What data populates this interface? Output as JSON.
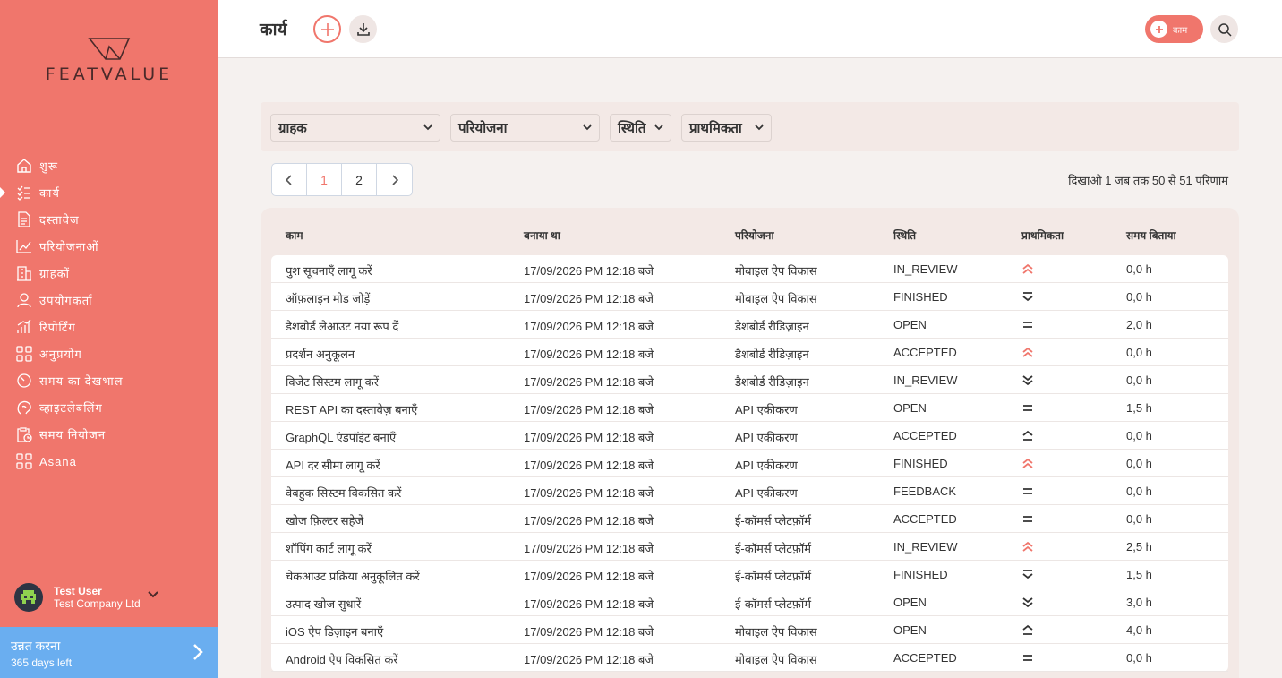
{
  "app": {
    "logo_text": "FEATVALUE",
    "page_title": "कार्य"
  },
  "sidebar": {
    "items": [
      {
        "label": "शुरू",
        "icon": "home-icon"
      },
      {
        "label": "कार्य",
        "icon": "tasks-icon",
        "active": true
      },
      {
        "label": "दस्तावेज",
        "icon": "document-icon"
      },
      {
        "label": "परियोजनाओं",
        "icon": "projects-icon"
      },
      {
        "label": "ग्राहकों",
        "icon": "building-icon"
      },
      {
        "label": "उपयोगकर्ता",
        "icon": "user-icon"
      },
      {
        "label": "रिपोर्टिंग",
        "icon": "chart-icon"
      },
      {
        "label": "अनुप्रयोग",
        "icon": "apps-icon"
      },
      {
        "label": "समय का देखभाल",
        "icon": "timer-icon"
      },
      {
        "label": "व्हाइटलेबलिंग",
        "icon": "brain-icon"
      },
      {
        "label": "समय नियोजन",
        "icon": "clipboard-clock-icon"
      },
      {
        "label": "Asana",
        "icon": "apps-icon"
      }
    ],
    "user": {
      "name": "Test User",
      "company": "Test Company Ltd"
    },
    "upgrade": {
      "title": "उन्नत करना",
      "subtitle": "365 days left"
    }
  },
  "header": {
    "task_button_label": "काम"
  },
  "filters": {
    "customer": "ग्राहक",
    "project": "परियोजना",
    "status": "स्थिति",
    "priority": "प्राथमिकता"
  },
  "pagination": {
    "pages": [
      "1",
      "2"
    ],
    "current": "1",
    "result_text": "दिखाओ 1 जब तक 50 से 51 परिणाम"
  },
  "table": {
    "headers": {
      "task": "काम",
      "created": "बनाया था",
      "project": "परियोजना",
      "status": "स्थिति",
      "priority": "प्राथमिकता",
      "time": "समय बिताया"
    },
    "rows": [
      {
        "task": "पुश सूचनाएँ लागू करें",
        "created": "17/09/2026 PM 12:18 बजे",
        "project": "मोबाइल ऐप विकास",
        "status": "IN_REVIEW",
        "priority": "highest",
        "time": "0,0 h"
      },
      {
        "task": "ऑफ़लाइन मोड जोड़ें",
        "created": "17/09/2026 PM 12:18 बजे",
        "project": "मोबाइल ऐप विकास",
        "status": "FINISHED",
        "priority": "low",
        "time": "0,0 h"
      },
      {
        "task": "डैशबोर्ड लेआउट नया रूप दें",
        "created": "17/09/2026 PM 12:18 बजे",
        "project": "डैशबोर्ड रीडिज़ाइन",
        "status": "OPEN",
        "priority": "medium",
        "time": "2,0 h"
      },
      {
        "task": "प्रदर्शन अनुकूलन",
        "created": "17/09/2026 PM 12:18 बजे",
        "project": "डैशबोर्ड रीडिज़ाइन",
        "status": "ACCEPTED",
        "priority": "highest",
        "time": "0,0 h"
      },
      {
        "task": "विजेट सिस्टम लागू करें",
        "created": "17/09/2026 PM 12:18 बजे",
        "project": "डैशबोर्ड रीडिज़ाइन",
        "status": "IN_REVIEW",
        "priority": "lowest",
        "time": "0,0 h"
      },
      {
        "task": "REST API का दस्तावेज़ बनाएँ",
        "created": "17/09/2026 PM 12:18 बजे",
        "project": "API एकीकरण",
        "status": "OPEN",
        "priority": "medium",
        "time": "1,5 h"
      },
      {
        "task": "GraphQL एंडपॉइंट बनाएँ",
        "created": "17/09/2026 PM 12:18 बजे",
        "project": "API एकीकरण",
        "status": "ACCEPTED",
        "priority": "high",
        "time": "0,0 h"
      },
      {
        "task": "API दर सीमा लागू करें",
        "created": "17/09/2026 PM 12:18 बजे",
        "project": "API एकीकरण",
        "status": "FINISHED",
        "priority": "highest",
        "time": "0,0 h"
      },
      {
        "task": "वेबहुक सिस्टम विकसित करें",
        "created": "17/09/2026 PM 12:18 बजे",
        "project": "API एकीकरण",
        "status": "FEEDBACK",
        "priority": "medium",
        "time": "0,0 h"
      },
      {
        "task": "खोज फ़िल्टर सहेजें",
        "created": "17/09/2026 PM 12:18 बजे",
        "project": "ई-कॉमर्स प्लेटफ़ॉर्म",
        "status": "ACCEPTED",
        "priority": "medium",
        "time": "0,0 h"
      },
      {
        "task": "शॉपिंग कार्ट लागू करें",
        "created": "17/09/2026 PM 12:18 बजे",
        "project": "ई-कॉमर्स प्लेटफ़ॉर्म",
        "status": "IN_REVIEW",
        "priority": "highest",
        "time": "2,5 h"
      },
      {
        "task": "चेकआउट प्रक्रिया अनुकूलित करें",
        "created": "17/09/2026 PM 12:18 बजे",
        "project": "ई-कॉमर्स प्लेटफ़ॉर्म",
        "status": "FINISHED",
        "priority": "low",
        "time": "1,5 h"
      },
      {
        "task": "उत्पाद खोज सुधारें",
        "created": "17/09/2026 PM 12:18 बजे",
        "project": "ई-कॉमर्स प्लेटफ़ॉर्म",
        "status": "OPEN",
        "priority": "lowest",
        "time": "3,0 h"
      },
      {
        "task": "iOS ऐप डिज़ाइन बनाएँ",
        "created": "17/09/2026 PM 12:18 बजे",
        "project": "मोबाइल ऐप विकास",
        "status": "OPEN",
        "priority": "high",
        "time": "4,0 h"
      },
      {
        "task": "Android ऐप विकसित करें",
        "created": "17/09/2026 PM 12:18 बजे",
        "project": "मोबाइल ऐप विकास",
        "status": "ACCEPTED",
        "priority": "medium",
        "time": "0,0 h"
      }
    ]
  },
  "colors": {
    "accent": "#f0766c",
    "upgrade": "#6aaef0",
    "priority_high": "#f0766c",
    "priority_neutral": "#333333"
  }
}
